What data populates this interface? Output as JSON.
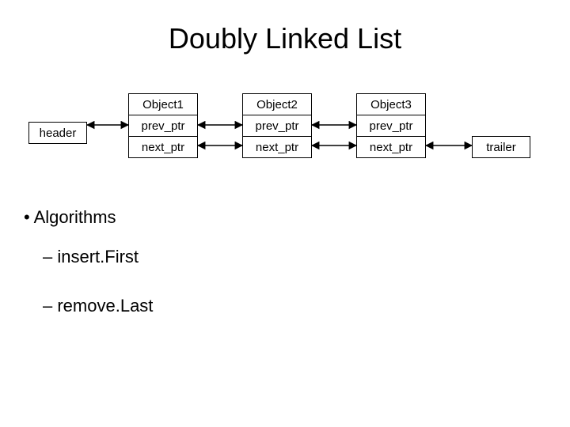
{
  "title": "Doubly Linked List",
  "header": {
    "label": "header"
  },
  "trailer": {
    "label": "trailer"
  },
  "nodes": [
    {
      "obj": "Object1",
      "prev": "prev_ptr",
      "next": "next_ptr"
    },
    {
      "obj": "Object2",
      "prev": "prev_ptr",
      "next": "next_ptr"
    },
    {
      "obj": "Object3",
      "prev": "prev_ptr",
      "next": "next_ptr"
    }
  ],
  "bullets": {
    "main": "Algorithms",
    "sub1": "insert.First",
    "sub2": "remove.Last"
  }
}
